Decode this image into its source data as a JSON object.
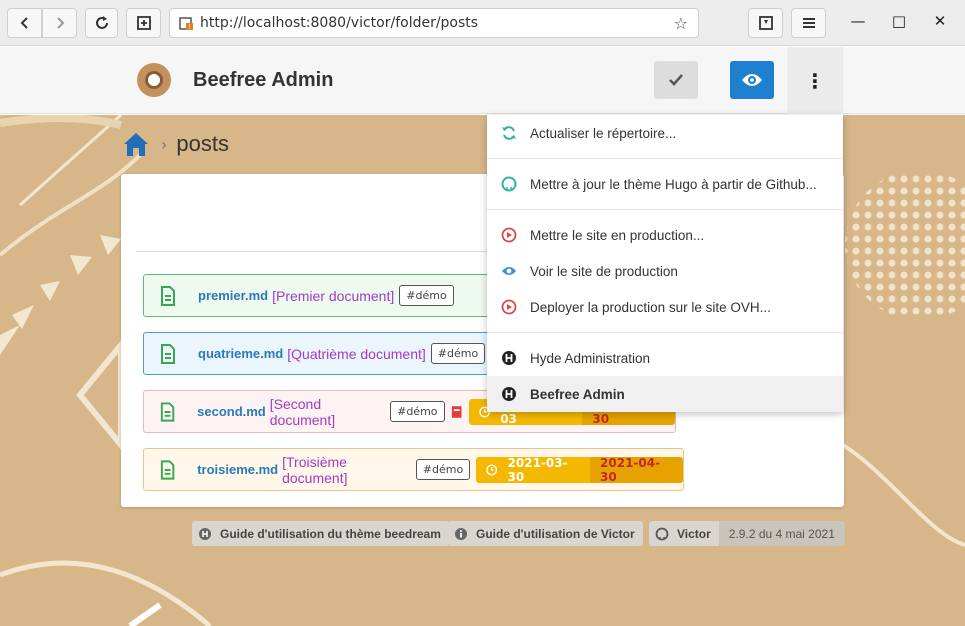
{
  "browser": {
    "url": "http://localhost:8080/victor/folder/posts"
  },
  "header": {
    "app_title": "Beefree Admin"
  },
  "breadcrumb": {
    "current": "posts"
  },
  "documents": [
    {
      "file": "premier.md",
      "title": "[Premier document]",
      "tag": "#démo",
      "start": "",
      "end": ""
    },
    {
      "file": "quatrieme.md",
      "title": "[Quatrième document]",
      "tag": "#démo",
      "start": "",
      "end": ""
    },
    {
      "file": "second.md",
      "title": "[Second document]",
      "tag": "#démo",
      "start": "2021-01-03",
      "end": "2021-05-30"
    },
    {
      "file": "troisieme.md",
      "title": "[Troisième document]",
      "tag": "#démo",
      "start": "2021-03-30",
      "end": "2021-04-30"
    }
  ],
  "dropdown": {
    "items": [
      {
        "label": "Actualiser le répertoire...",
        "icon": "refresh-icon"
      },
      {
        "label": "Mettre à jour le thème Hugo à partir de Github...",
        "icon": "github-icon"
      },
      {
        "label": "Mettre le site en production...",
        "icon": "play-icon"
      },
      {
        "label": "Voir le site de production",
        "icon": "eye-icon"
      },
      {
        "label": "Deployer la production sur le site OVH...",
        "icon": "play-icon"
      },
      {
        "label": "Hyde Administration",
        "icon": "hugo-icon"
      },
      {
        "label": "Beefree Admin",
        "icon": "hugo-icon"
      }
    ]
  },
  "footer": {
    "guide_theme": "Guide d'utilisation du thème beedream",
    "guide_victor": "Guide d'utilisation de Victor",
    "victor": "Victor",
    "version": "2.9.2 du 4 mai 2021"
  },
  "colors": {
    "primary": "#1f7fd1",
    "background": "#d7b789",
    "date_start": "#f5b800",
    "date_end": "#c62828"
  }
}
